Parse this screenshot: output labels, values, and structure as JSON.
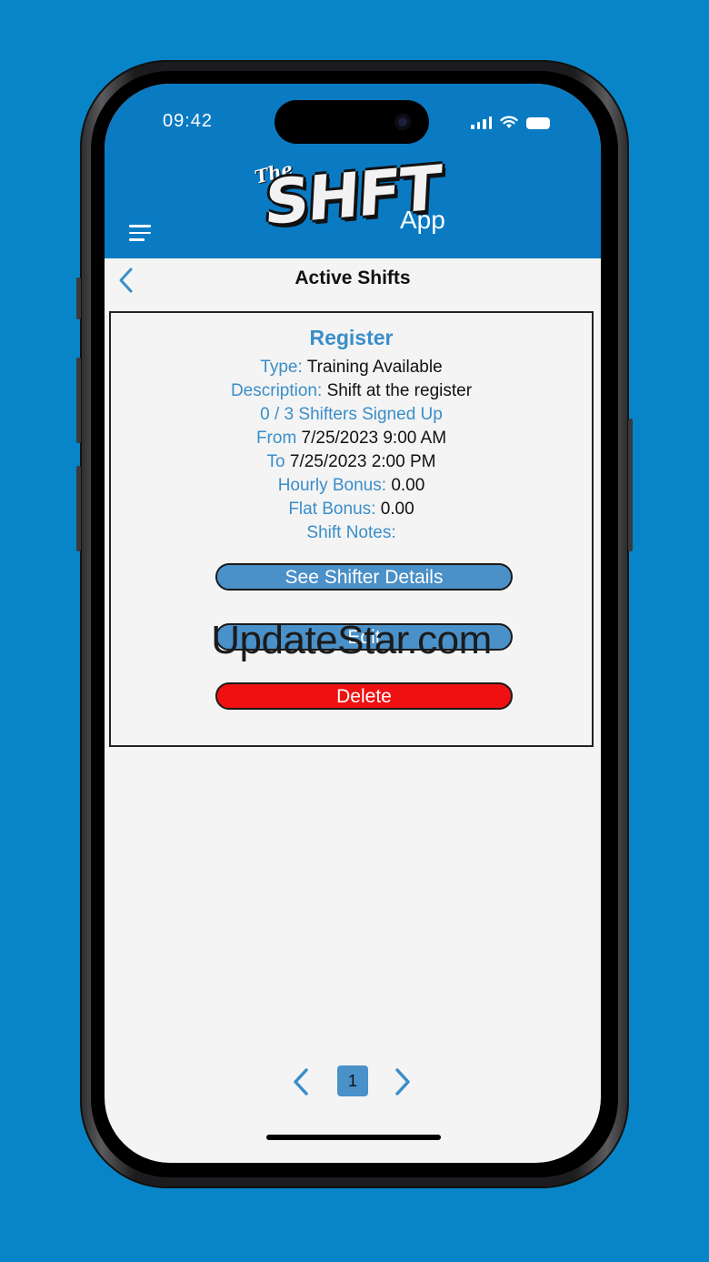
{
  "status_bar": {
    "time": "09:42"
  },
  "logo": {
    "the": "The",
    "shft": "SHFT",
    "app": "App"
  },
  "nav": {
    "title": "Active Shifts"
  },
  "shift": {
    "title": "Register",
    "type_label": "Type:",
    "type_value": "Training Available",
    "description_label": "Description:",
    "description_value": "Shift at the register",
    "signups": "0 / 3 Shifters Signed Up",
    "from_label": "From",
    "from_value": "7/25/2023 9:00 AM",
    "to_label": "To",
    "to_value": "7/25/2023 2:00 PM",
    "hourly_label": "Hourly Bonus:",
    "hourly_value": "0.00",
    "flat_label": "Flat Bonus:",
    "flat_value": "0.00",
    "notes_label": "Shift Notes:"
  },
  "actions": {
    "details": "See Shifter Details",
    "edit": "Edit",
    "delete": "Delete"
  },
  "watermark": "UpdateStar.com",
  "pagination": {
    "current_page": "1"
  },
  "colors": {
    "background": "#0885c8",
    "header": "#0a7bc3",
    "label_blue": "#3a8ec9",
    "button_blue": "#4a90c9",
    "delete_red": "#ef1111"
  },
  "icons": {
    "menu": "hamburger-icon",
    "back": "chevron-left-icon",
    "prev": "chevron-left-icon",
    "next": "chevron-right-icon",
    "signal": "signal-icon",
    "wifi": "wifi-icon",
    "battery": "battery-icon"
  }
}
